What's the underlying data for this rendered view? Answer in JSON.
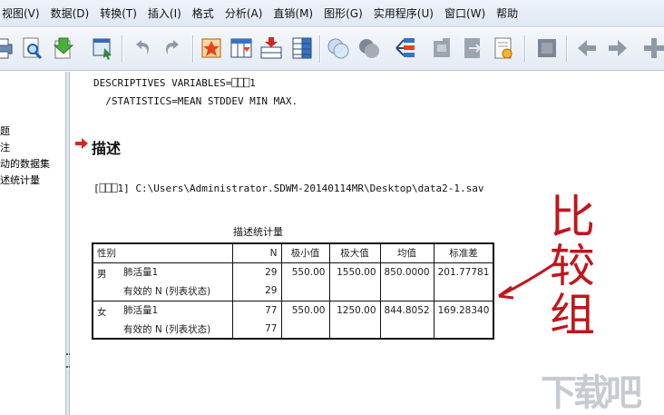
{
  "menu": {
    "items": [
      "视图(V)",
      "数据(D)",
      "转换(T)",
      "插入(I)",
      "格式",
      "分析(A)",
      "直销(M)",
      "图形(G)",
      "实用程序(U)",
      "窗口(W)",
      "帮助"
    ]
  },
  "toolbar": {
    "icons": [
      "print-icon",
      "print-preview-icon",
      "export-icon",
      "select-output-icon",
      "undo-icon",
      "redo-icon",
      "goto-case-icon",
      "goto-variable-icon",
      "insert-cases-icon",
      "variables-icon",
      "ungrouped-icon",
      "group-icon",
      "split-file-icon",
      "weight-cases-icon",
      "select-cases-icon",
      "value-labels-icon",
      "use-sets-icon",
      "show-all-icon",
      "back-icon",
      "forward-icon",
      "expand-icon"
    ]
  },
  "outline": {
    "items": [
      "题",
      "注",
      "动的数据集",
      "述统计量"
    ]
  },
  "output": {
    "syntax_line1": "DESCRIPTIVES VARIABLES=⎕⎕⎕1",
    "syntax_line2": "  /STATISTICS=MEAN STDDEV MIN MAX.",
    "heading": "描述",
    "dataset_path": "[⎕⎕⎕1] C:\\Users\\Administrator.SDWM-20140114MR\\Desktop\\data2-1.sav",
    "table": {
      "title": "描述统计量",
      "header_group": "性别",
      "columns": [
        "N",
        "极小值",
        "极大值",
        "均值",
        "标准差"
      ],
      "groups": [
        {
          "label": "男",
          "rows": [
            {
              "label": "肺活量1",
              "n": "29",
              "min": "550.00",
              "max": "1550.00",
              "mean": "850.0000",
              "sd": "201.77781"
            },
            {
              "label": "有效的 N (列表状态)",
              "n": "29",
              "min": "",
              "max": "",
              "mean": "",
              "sd": ""
            }
          ]
        },
        {
          "label": "女",
          "rows": [
            {
              "label": "肺活量1",
              "n": "77",
              "min": "550.00",
              "max": "1250.00",
              "mean": "844.8052",
              "sd": "169.28340"
            },
            {
              "label": "有效的 N (列表状态)",
              "n": "77",
              "min": "",
              "max": "",
              "mean": "",
              "sd": ""
            }
          ]
        }
      ]
    }
  },
  "annotation": {
    "chars": [
      "比",
      "较",
      "组"
    ],
    "color": "#c0161b"
  },
  "watermark": "下载吧"
}
